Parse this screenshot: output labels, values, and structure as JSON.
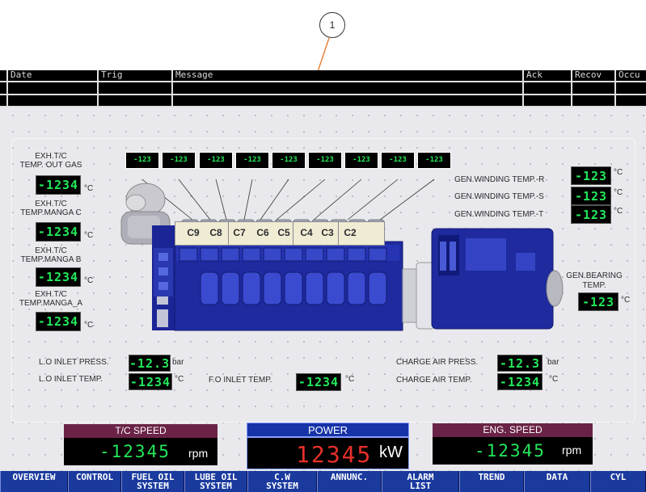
{
  "callout": {
    "number": "1"
  },
  "alarm_table": {
    "headers": [
      "Date",
      "Trig",
      "Message",
      "Ack",
      "Recov",
      "Occu"
    ]
  },
  "engine": {
    "cylinders": [
      "C9",
      "C8",
      "C7",
      "C6",
      "C5",
      "C4",
      "C3",
      "C2"
    ],
    "cyl_temps": [
      "-123",
      "-123",
      "-123",
      "-123",
      "-123",
      "-123",
      "-123",
      "-123",
      "-123"
    ],
    "exh_tc_out": {
      "label_1": "EXH.T/C",
      "label_2": "TEMP. OUT GAS",
      "value": "-1234",
      "unit": "°C"
    },
    "exh_manga_c": {
      "label_1": "EXH.T/C",
      "label_2": "TEMP.MANGA C",
      "value": "-1234",
      "unit": "°C"
    },
    "exh_manga_b": {
      "label_1": "EXH.T/C",
      "label_2": "TEMP.MANGA B",
      "value": "-1234",
      "unit": "°C"
    },
    "exh_manga_a": {
      "label_1": "EXH.T/C",
      "label_2": "TEMP.MANGA_A",
      "value": "-1234",
      "unit": "°C"
    },
    "gen_winding_r": {
      "label": "GEN.WINDING TEMP.-R",
      "value": "-123",
      "unit": "°C"
    },
    "gen_winding_s": {
      "label": "GEN.WINDING TEMP.-S",
      "value": "-123",
      "unit": "°C"
    },
    "gen_winding_t": {
      "label": "GEN.WINDING TEMP.-T",
      "value": "-123",
      "unit": "°C"
    },
    "gen_bearing": {
      "label_1": "GEN.BEARING",
      "label_2": "TEMP.",
      "value": "-123",
      "unit": "°C"
    },
    "lo_inlet_press": {
      "label": "L.O INLET PRESS.",
      "value": "-12.3",
      "unit": "bar"
    },
    "lo_inlet_temp": {
      "label": "L.O INLET TEMP.",
      "value": "-1234",
      "unit": "°C"
    },
    "fo_inlet_temp": {
      "label": "F.O INLET TEMP.",
      "value": "-1234",
      "unit": "°C"
    },
    "charge_air_press": {
      "label": "CHARGE AIR PRESS.",
      "value": "-12.3",
      "unit": "bar"
    },
    "charge_air_temp": {
      "label": "CHARGE AIR TEMP.",
      "value": "-1234",
      "unit": "°C"
    }
  },
  "gauges": {
    "tc_speed": {
      "title": "T/C SPEED",
      "value": "-12345",
      "unit": "rpm"
    },
    "power": {
      "title": "POWER",
      "value": "12345",
      "unit": "kW"
    },
    "eng_speed": {
      "title": "ENG. SPEED",
      "value": "-12345",
      "unit": "rpm"
    }
  },
  "nav": [
    {
      "label": "OVERVIEW"
    },
    {
      "label": "CONTROL"
    },
    {
      "label": "FUEL OIL\nSYSTEM"
    },
    {
      "label": "LUBE OIL\nSYSTEM"
    },
    {
      "label": "C.W\nSYSTEM"
    },
    {
      "label": "ANNUNC."
    },
    {
      "label": "ALARM\nLIST"
    },
    {
      "label": "TREND"
    },
    {
      "label": "DATA"
    },
    {
      "label": "CYL"
    }
  ],
  "colors": {
    "display_green": "#23e85a",
    "power_red": "#e8302a",
    "engine_blue": "#1e2a9e",
    "nav_blue": "#1a3a9e",
    "tc_title_bg": "#6a2346",
    "power_title_bg": "#1733a8"
  }
}
